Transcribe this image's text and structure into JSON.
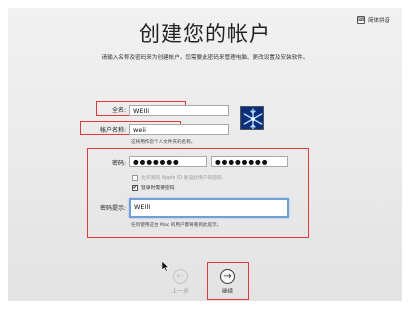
{
  "header": {
    "language_button": "简体拼音",
    "language_icon": "input-menu-icon",
    "title": "创建您的帐户",
    "subtitle": "请输入名称及密码来为创建帐户。您需要此密码来管理电脑、更改设置及安装软件。"
  },
  "form": {
    "full_name_label": "全名:",
    "full_name_value": "WEIli",
    "account_name_label": "帐户名称:",
    "account_name_value": "weii",
    "account_hint": "这将用作您个人文件夹的名称。",
    "password_label": "密码:",
    "password_value": "●●●●●●●",
    "verify_value": "●●●●●●●●",
    "apple_id_option": "允许我的 Apple ID 重设此用户的密码",
    "apple_id_checked": false,
    "require_password_option": "登录时需要密码",
    "require_password_checked": true,
    "password_hint_label": "密码提示:",
    "password_hint_value": "WEIlI",
    "password_hint_note": "任何使用这台 Mac 的用户都将看到此提示。"
  },
  "navigation": {
    "back_label": "上一步",
    "continue_label": "继续"
  },
  "colors": {
    "highlight": "#e23a3a",
    "focus_ring": "#6f9fd8"
  }
}
